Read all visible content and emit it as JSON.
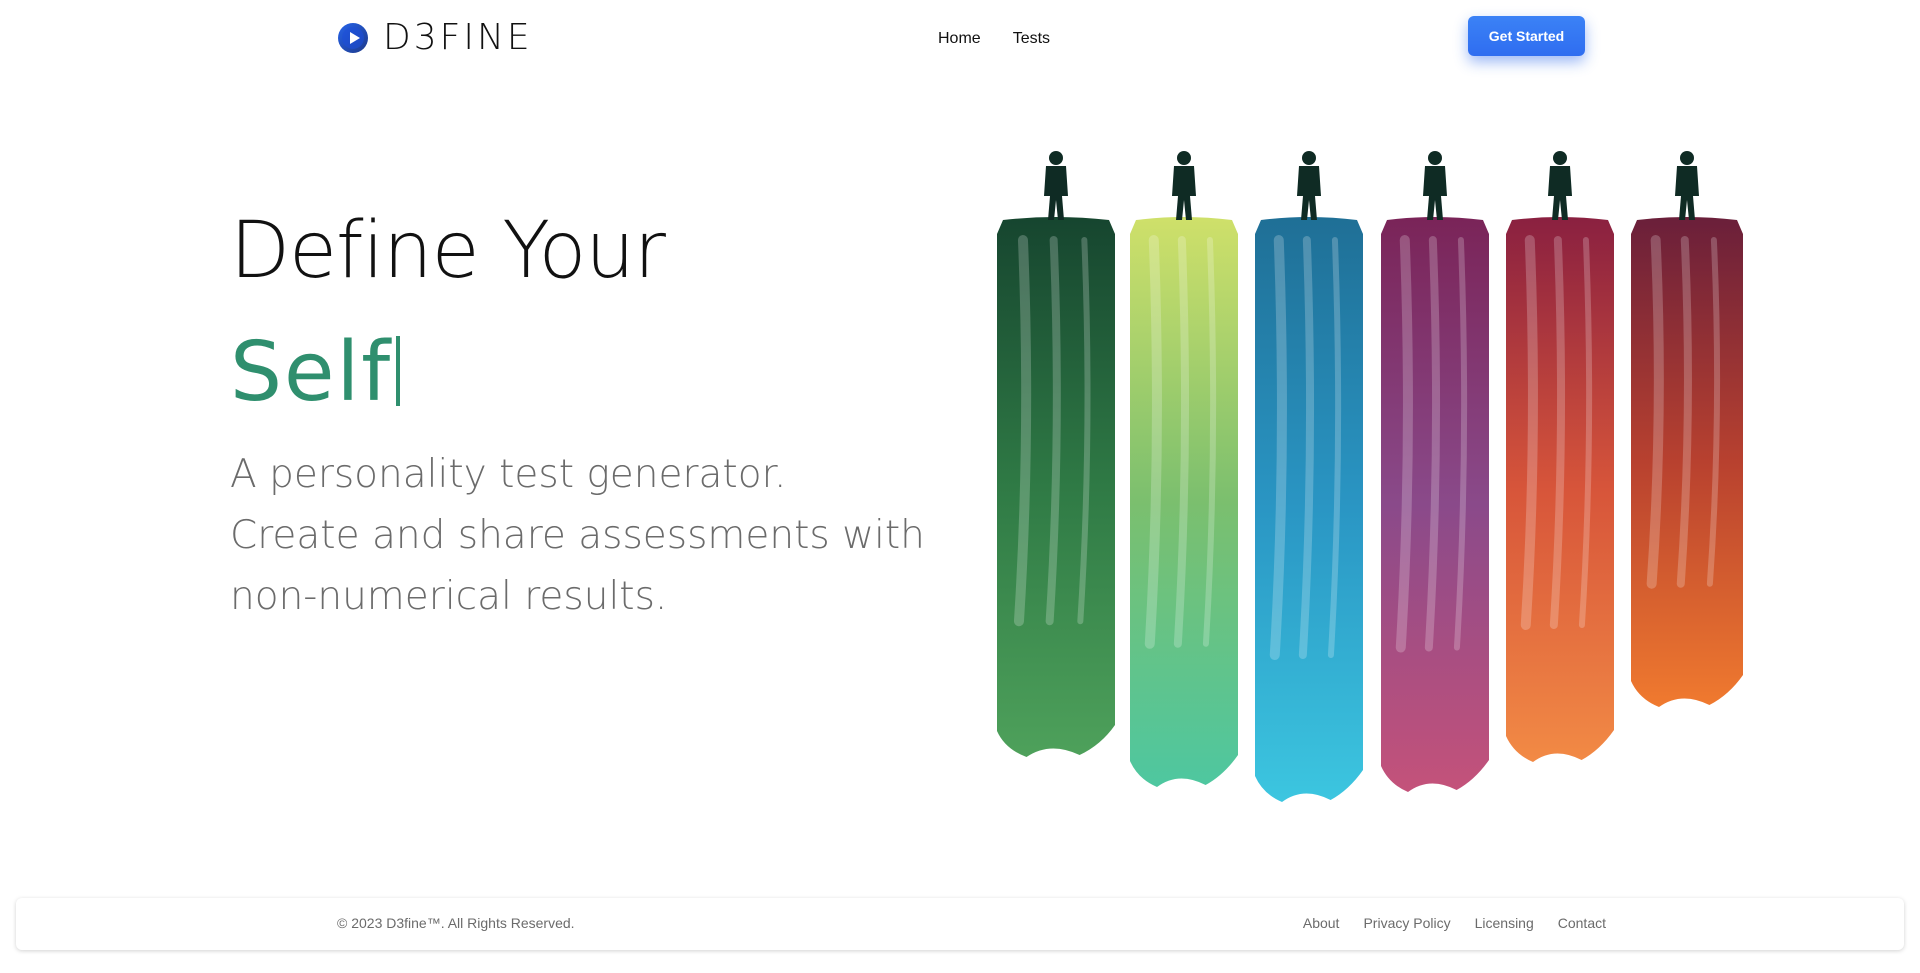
{
  "brand": {
    "name": "D3FINE",
    "icon": "play-circle-icon"
  },
  "nav": {
    "items": [
      "Home",
      "Tests"
    ]
  },
  "header": {
    "cta_label": "Get Started"
  },
  "hero": {
    "title": "Define Your",
    "word": "Self",
    "description_lines": [
      "A personality test generator.",
      "Create and share assessments with",
      "non-numerical results."
    ]
  },
  "illustration": {
    "panel_colors": [
      [
        "#16452f",
        "#2f7a45",
        "#4ea15b"
      ],
      [
        "#cfe06a",
        "#7bbf6e",
        "#4ec7a0"
      ],
      [
        "#1f6f96",
        "#2a96c4",
        "#3cc6e0"
      ],
      [
        "#7a2458",
        "#8a4a8a",
        "#c4527a"
      ],
      [
        "#8a2040",
        "#d7553a",
        "#f28a45"
      ],
      [
        "#6a1f3a",
        "#b8412f",
        "#f07a2f"
      ]
    ],
    "figure_color": "#0f2b24"
  },
  "footer": {
    "copyright": "© 2023 D3fine™. All Rights Reserved.",
    "links": [
      "About",
      "Privacy Policy",
      "Licensing",
      "Contact"
    ]
  },
  "colors": {
    "accent": "#2f8f6e",
    "button": "#2f6df0"
  }
}
